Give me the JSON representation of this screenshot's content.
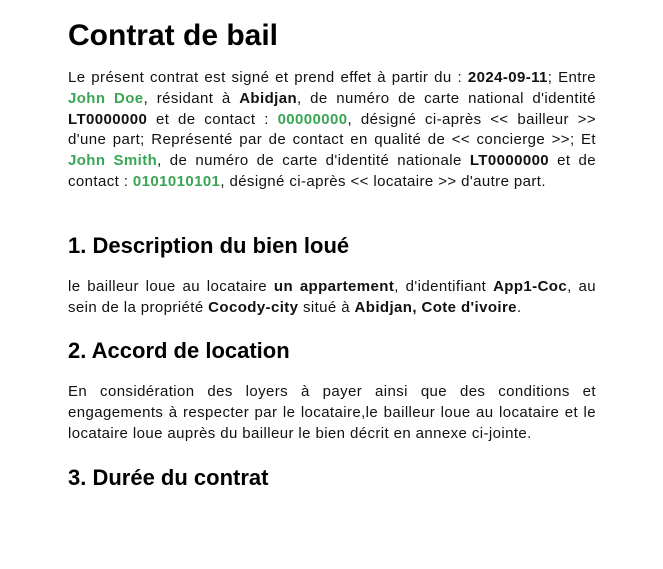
{
  "title": "Contrat de bail",
  "intro": {
    "t1": "Le présent contrat est signé et prend effet à partir du : ",
    "date": "2024-09-11",
    "t2": "; Entre ",
    "landlord_name": "John Doe",
    "t3": ", résidant à ",
    "landlord_city": "Abidjan",
    "t4": ", de numéro de carte national d'identité ",
    "landlord_id": "LT0000000",
    "t5": " et de contact : ",
    "landlord_contact": "00000000",
    "t6": ", désigné ci-après << bailleur >> d'une part; Représenté par de contact en qualité de << concierge >>; Et ",
    "tenant_name": "John Smith",
    "t7": ", de numéro de carte d'identité nationale ",
    "tenant_id": "LT0000000",
    "t8": " et de contact : ",
    "tenant_contact": "0101010101",
    "t9": ", désigné ci-après << locataire >> d'autre part."
  },
  "section1": {
    "heading": "1. Description du bien loué",
    "t1": "le bailleur loue au locataire ",
    "property_type": "un appartement",
    "t2": ", d'identifiant ",
    "property_id": "App1-Coc",
    "t3": ", au sein de la propriété ",
    "property_name": "Cocody-city",
    "t4": " situé à ",
    "property_location": "Abidjan, Cote d'ivoire",
    "t5": "."
  },
  "section2": {
    "heading": "2. Accord de location",
    "text": "En considération des loyers à payer ainsi que des conditions et engagements à respecter par le locataire,le bailleur loue au locataire et le locataire loue auprès du bailleur le bien décrit en annexe ci-jointe."
  },
  "section3": {
    "heading": "3. Durée du contrat"
  },
  "colors": {
    "highlight": "#3aa655",
    "text": "#111111"
  }
}
